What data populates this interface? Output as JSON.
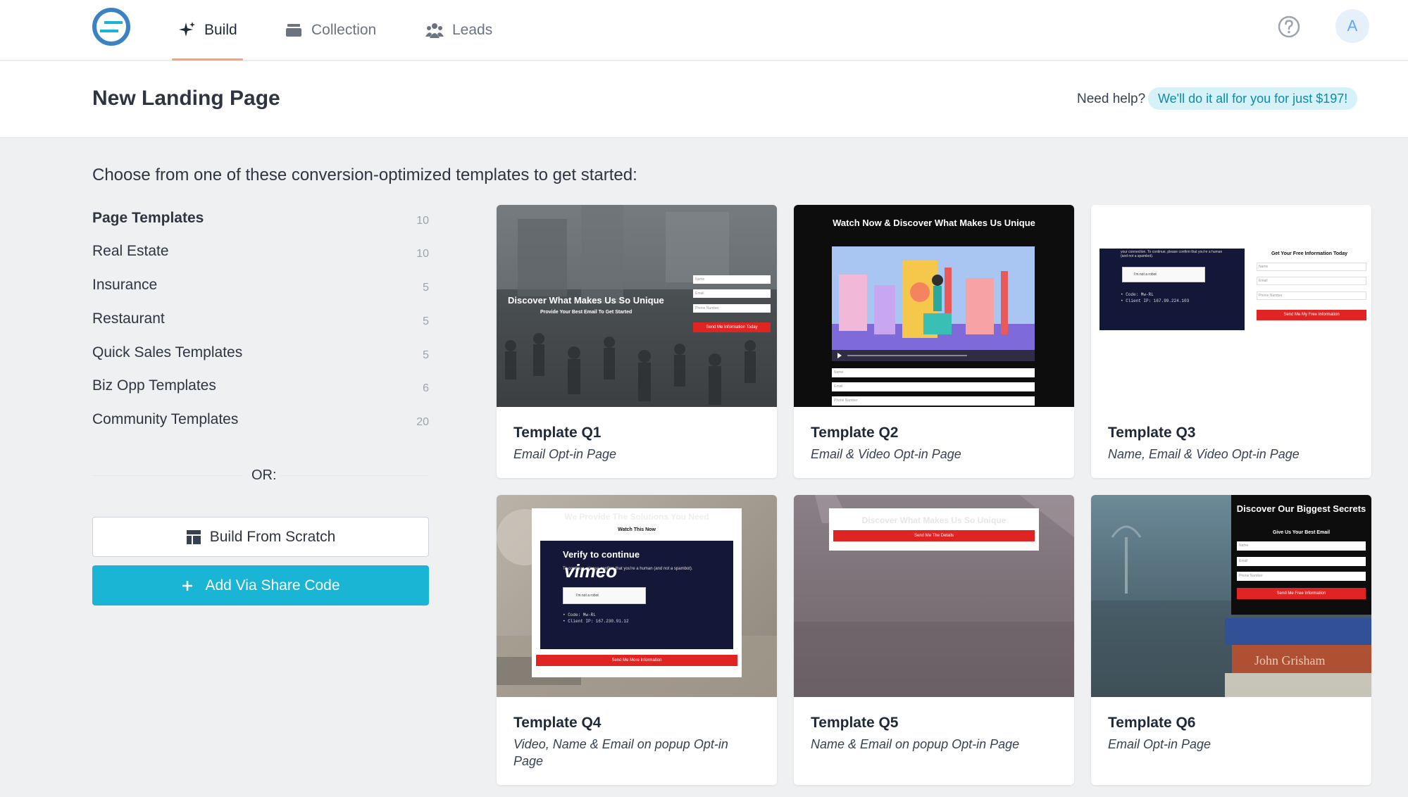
{
  "nav": {
    "tabs": [
      {
        "label": "Build",
        "icon": "sparkle-icon"
      },
      {
        "label": "Collection",
        "icon": "stack-icon"
      },
      {
        "label": "Leads",
        "icon": "people-icon"
      }
    ],
    "avatar_initial": "A"
  },
  "header": {
    "title": "New Landing Page",
    "need_help": "Need help?",
    "help_offer": "We'll do it all for you for just $197!"
  },
  "intro": "Choose from one of these conversion-optimized templates to get started:",
  "sidebar": {
    "items": [
      {
        "label": "Page Templates",
        "count": "10"
      },
      {
        "label": "Real Estate",
        "count": "10"
      },
      {
        "label": "Insurance",
        "count": "5"
      },
      {
        "label": "Restaurant",
        "count": "5"
      },
      {
        "label": "Quick Sales Templates",
        "count": "5"
      },
      {
        "label": "Biz Opp Templates",
        "count": "6"
      },
      {
        "label": "Community Templates",
        "count": "20"
      }
    ],
    "or_label": "OR:",
    "build_from_scratch": "Build From Scratch",
    "add_share_code": "Add Via Share Code"
  },
  "templates": [
    {
      "title": "Template Q1",
      "subtitle": "Email Opt-in Page"
    },
    {
      "title": "Template Q2",
      "subtitle": "Email & Video Opt-in Page"
    },
    {
      "title": "Template Q3",
      "subtitle": "Name, Email & Video Opt-in Page"
    },
    {
      "title": "Template Q4",
      "subtitle": "Video, Name & Email on popup Opt-in Page"
    },
    {
      "title": "Template Q5",
      "subtitle": "Name & Email on popup Opt-in Page"
    },
    {
      "title": "Template Q6",
      "subtitle": "Email Opt-in Page"
    }
  ],
  "previews": {
    "q1": {
      "headline": "Discover What Makes Us So Unique",
      "sub": "Provide Your Best Email To Get Started",
      "f1": "Name",
      "f2": "Email",
      "f3": "Phone Number",
      "cta": "Send Me Information Today"
    },
    "q2": {
      "headline": "Watch Now & Discover What Makes Us Unique",
      "f1": "Name",
      "f2": "Email",
      "f3": "Phone Number"
    },
    "q3": {
      "headline": "Get Your Free Information Today",
      "f1": "Name",
      "f2": "Email",
      "f3": "Phone Number",
      "cta": "Send Me My Free Information",
      "robot": "I'm not a robot",
      "code1": "• Code: Mw-RL",
      "code2": "• Client IP: 167.99.224.103",
      "notice": "your connection. To continue, please confirm that you're a human (and not a spambot)."
    },
    "q4": {
      "headline": "We Provide The Solutions You Need",
      "sub": "Watch This Now",
      "verify": "Verify to continue",
      "brand": "vimeo",
      "notice": "To continue, please confirm that you're a human (and not a spambot).",
      "robot": "I'm not a robot",
      "code1": "• Code: Mw-RL",
      "code2": "• Client IP: 167.230.91.12",
      "cta": "Send Me More Information"
    },
    "q5": {
      "headline": "Discover What Makes Us So Unique",
      "cta": "Send Me The Details"
    },
    "q6": {
      "headline": "Discover Our Biggest Secrets",
      "sub": "Give Us Your Best Email",
      "f1": "Name",
      "f2": "Email",
      "f3": "Phone Number",
      "cta": "Send Me Free Information",
      "book1": "John Grisham"
    }
  },
  "colors": {
    "accent": "#1ab5d5",
    "tab_underline": "#f0a57e",
    "cta_red": "#e02424"
  }
}
